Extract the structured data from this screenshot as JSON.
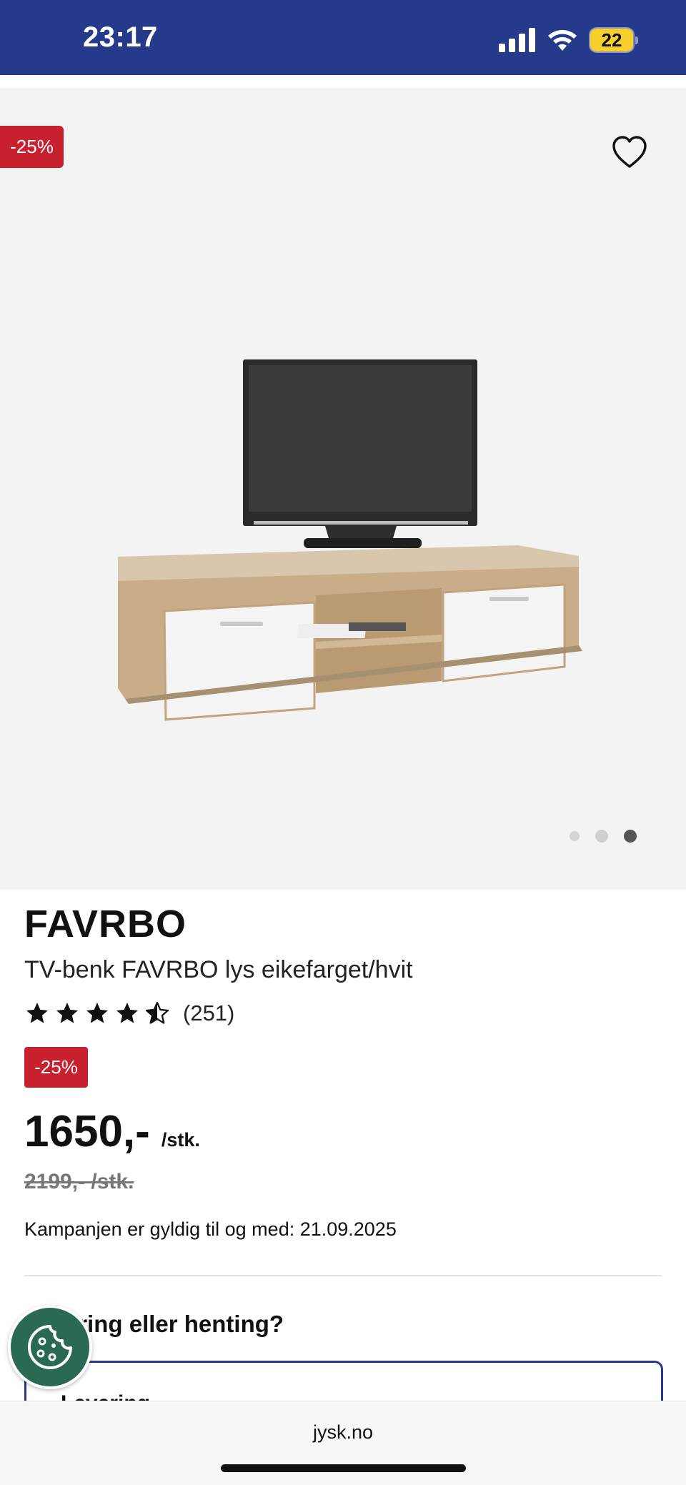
{
  "status_bar": {
    "time": "23:17",
    "battery_level": "22",
    "icons": [
      "signal-icon",
      "wifi-icon",
      "battery-icon"
    ],
    "background": "#263a8c"
  },
  "gallery": {
    "discount_badge": "-25%",
    "favorite_icon": "heart-icon",
    "image_description_icon": "product-image",
    "page_count": 3,
    "active_page": 3
  },
  "product": {
    "brand": "FAVRBO",
    "title": "TV-benk FAVRBO lys eikefarget/hvit",
    "rating": 4.5,
    "rating_count": "(251)",
    "discount_badge": "-25%",
    "price": "1650,-",
    "price_unit": "/stk.",
    "old_price": "2199,- /stk.",
    "campaign_text": "Kampanjen er gyldig til og med: 21.09.2025"
  },
  "delivery": {
    "title": "Levering eller henting?",
    "option_label": "Levering"
  },
  "cookie_button": {
    "icon": "cookie-icon",
    "color": "#2b6a52"
  },
  "browser": {
    "url": "jysk.no"
  },
  "colors": {
    "accent": "#263a8c",
    "sale": "#c8202e"
  }
}
